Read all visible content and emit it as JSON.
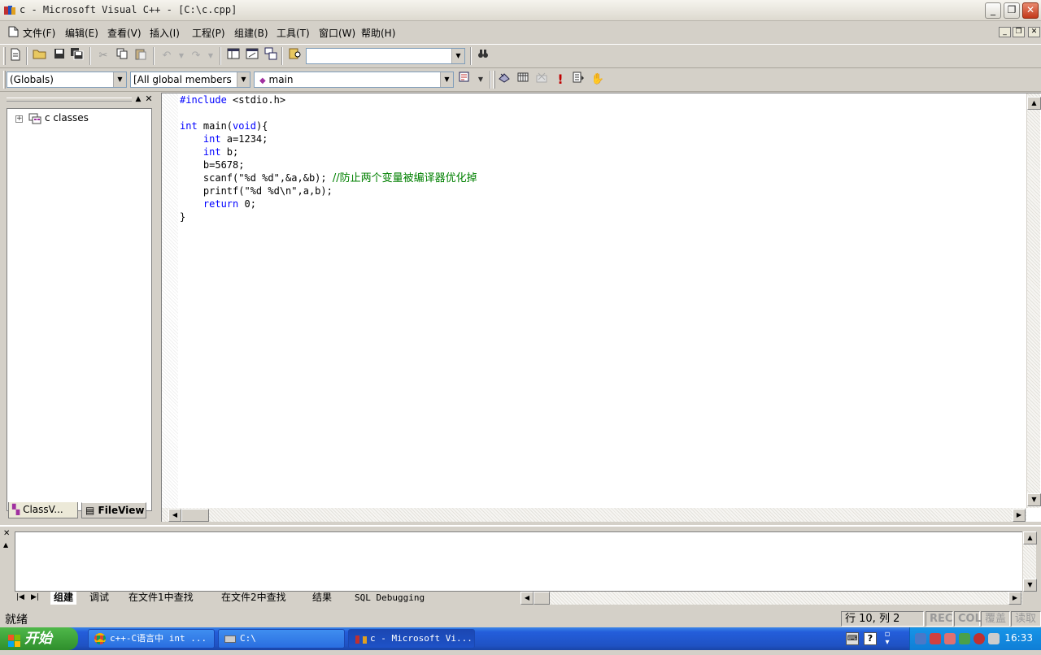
{
  "window": {
    "title": "c - Microsoft Visual C++ - [C:\\c.cpp]"
  },
  "menu": [
    "文件(F)",
    "编辑(E)",
    "查看(V)",
    "插入(I)",
    "工程(P)",
    "组建(B)",
    "工具(T)",
    "窗口(W)",
    "帮助(H)"
  ],
  "toolbar": {
    "find_combo_value": ""
  },
  "wizardbar": {
    "scope": "(Globals)",
    "filter": "[All global members",
    "member": "main"
  },
  "leftpane": {
    "tree_root": "c classes",
    "tab_classview": "ClassV...",
    "tab_fileview": "FileView"
  },
  "code": {
    "lines": [
      {
        "kw": "#include",
        "text": " <stdio.h>",
        "comment": ""
      },
      {
        "kw": "",
        "text": "",
        "comment": ""
      },
      {
        "kw": "int",
        "text": " main(void){",
        "comment": "",
        "kw2": "void"
      },
      {
        "kw": "    int",
        "text": " a=1234;",
        "comment": ""
      },
      {
        "kw": "    int",
        "text": " b;",
        "comment": ""
      },
      {
        "kw": "",
        "text": "    b=5678;",
        "comment": ""
      },
      {
        "kw": "",
        "text": "    scanf(\"%d %d\",&a,&b); ",
        "comment": "//防止两个变量被编译器优化掉"
      },
      {
        "kw": "",
        "text": "    printf(\"%d %d\\n\",a,b);",
        "comment": ""
      },
      {
        "kw": "    return",
        "text": " 0;",
        "comment": ""
      },
      {
        "kw": "",
        "text": "}",
        "comment": ""
      }
    ]
  },
  "output": {
    "tabs": [
      "组建",
      "调试",
      "在文件1中查找",
      "在文件2中查找",
      "结果",
      "SQL Debugging"
    ]
  },
  "status": {
    "message": "就绪",
    "position": "行 10, 列 2",
    "rec": "REC",
    "col": "COL",
    "ovr": "覆盖",
    "read": "读取"
  },
  "taskbar": {
    "start": "开始",
    "tasks": [
      "c++-C语言中 int ...",
      "C:\\",
      "c - Microsoft Vi..."
    ],
    "clock": "16:33"
  }
}
